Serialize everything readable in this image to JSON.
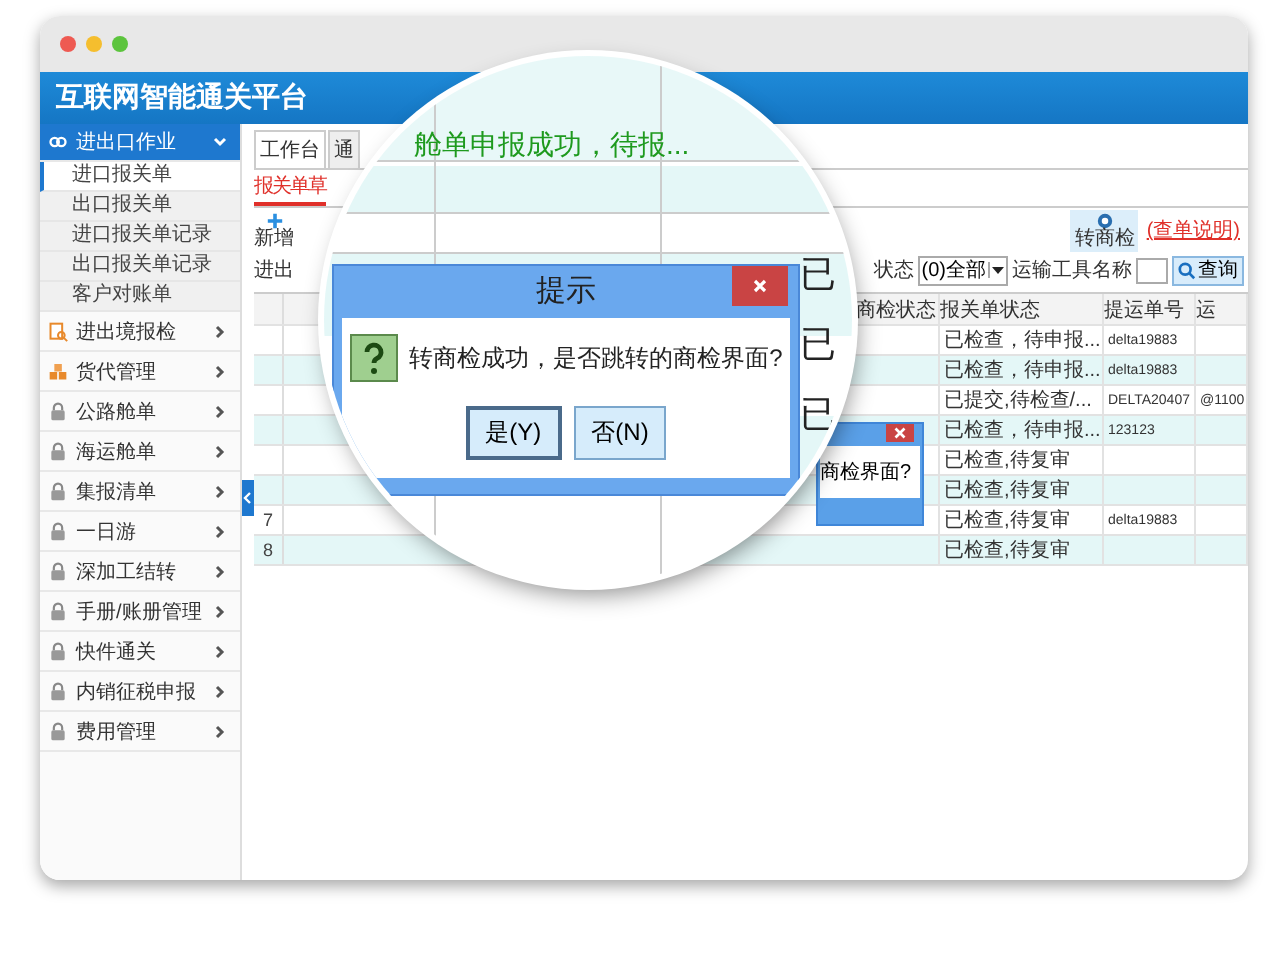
{
  "window": {
    "title": "互联网智能通关平台"
  },
  "sidebar": {
    "groups": [
      {
        "label": "进出口作业",
        "expanded": true,
        "locked": false,
        "children": [
          {
            "label": "进口报关单",
            "selected": true
          },
          {
            "label": "出口报关单",
            "selected": false
          },
          {
            "label": "进口报关单记录",
            "selected": false
          },
          {
            "label": "出口报关单记录",
            "selected": false
          },
          {
            "label": "客户对账单",
            "selected": false
          }
        ]
      },
      {
        "label": "进出境报检",
        "expanded": false,
        "locked": false
      },
      {
        "label": "货代管理",
        "expanded": false,
        "locked": false
      },
      {
        "label": "公路舱单",
        "expanded": false,
        "locked": true
      },
      {
        "label": "海运舱单",
        "expanded": false,
        "locked": true
      },
      {
        "label": "集报清单",
        "expanded": false,
        "locked": true
      },
      {
        "label": "一日游",
        "expanded": false,
        "locked": true
      },
      {
        "label": "深加工结转",
        "expanded": false,
        "locked": true
      },
      {
        "label": "手册/账册管理",
        "expanded": false,
        "locked": true
      },
      {
        "label": "快件通关",
        "expanded": false,
        "locked": true
      },
      {
        "label": "内销征税申报",
        "expanded": false,
        "locked": true
      },
      {
        "label": "费用管理",
        "expanded": false,
        "locked": true
      }
    ]
  },
  "tabs": [
    {
      "label": "工作台",
      "selected": true
    },
    {
      "label": "通",
      "selected": false
    }
  ],
  "subtabs": [
    {
      "label": "报关单草",
      "selected": true
    }
  ],
  "toolbar": {
    "new_button": "新增",
    "transfer_button": "转商检",
    "help_link": "(查单说明)"
  },
  "filter": {
    "left_label": "进出",
    "status_label": "状态",
    "status_value": "(0)全部",
    "vehicle_label": "运输工具名称",
    "query_button": "查询"
  },
  "table": {
    "columns": [
      "商检状态",
      "报关单状态",
      "提运单号",
      "运"
    ],
    "rows": [
      {
        "customs_status": "已检查，待申报...",
        "bill_no": "delta19883"
      },
      {
        "customs_status": "已检查，待申报...",
        "bill_no": "delta19883"
      },
      {
        "customs_status": "已提交,待检查/...",
        "bill_no": "DELTA20407",
        "transport": "@1100"
      },
      {
        "customs_status": "已检查，待申报...",
        "bill_no": "123123"
      },
      {
        "customs_status": "已检查,待复审"
      },
      {
        "customs_status": "已检查,待复审"
      },
      {
        "number": "7",
        "customs_status": "已检查,待复审",
        "bill_no": "delta19883"
      },
      {
        "number": "8",
        "customs_status": "已检查,待复审"
      }
    ]
  },
  "background_dialog": {
    "message": "商检界面?"
  },
  "magnifier": {
    "message": "舱单申报成功，待报...",
    "status_cells": [
      "已",
      "已",
      "已"
    ],
    "dialog": {
      "title": "提示",
      "message": "转商检成功，是否跳转的商检界面?",
      "buttons": [
        {
          "label": "是(Y)",
          "selected": true
        },
        {
          "label": "否(N)",
          "selected": false
        }
      ]
    }
  }
}
